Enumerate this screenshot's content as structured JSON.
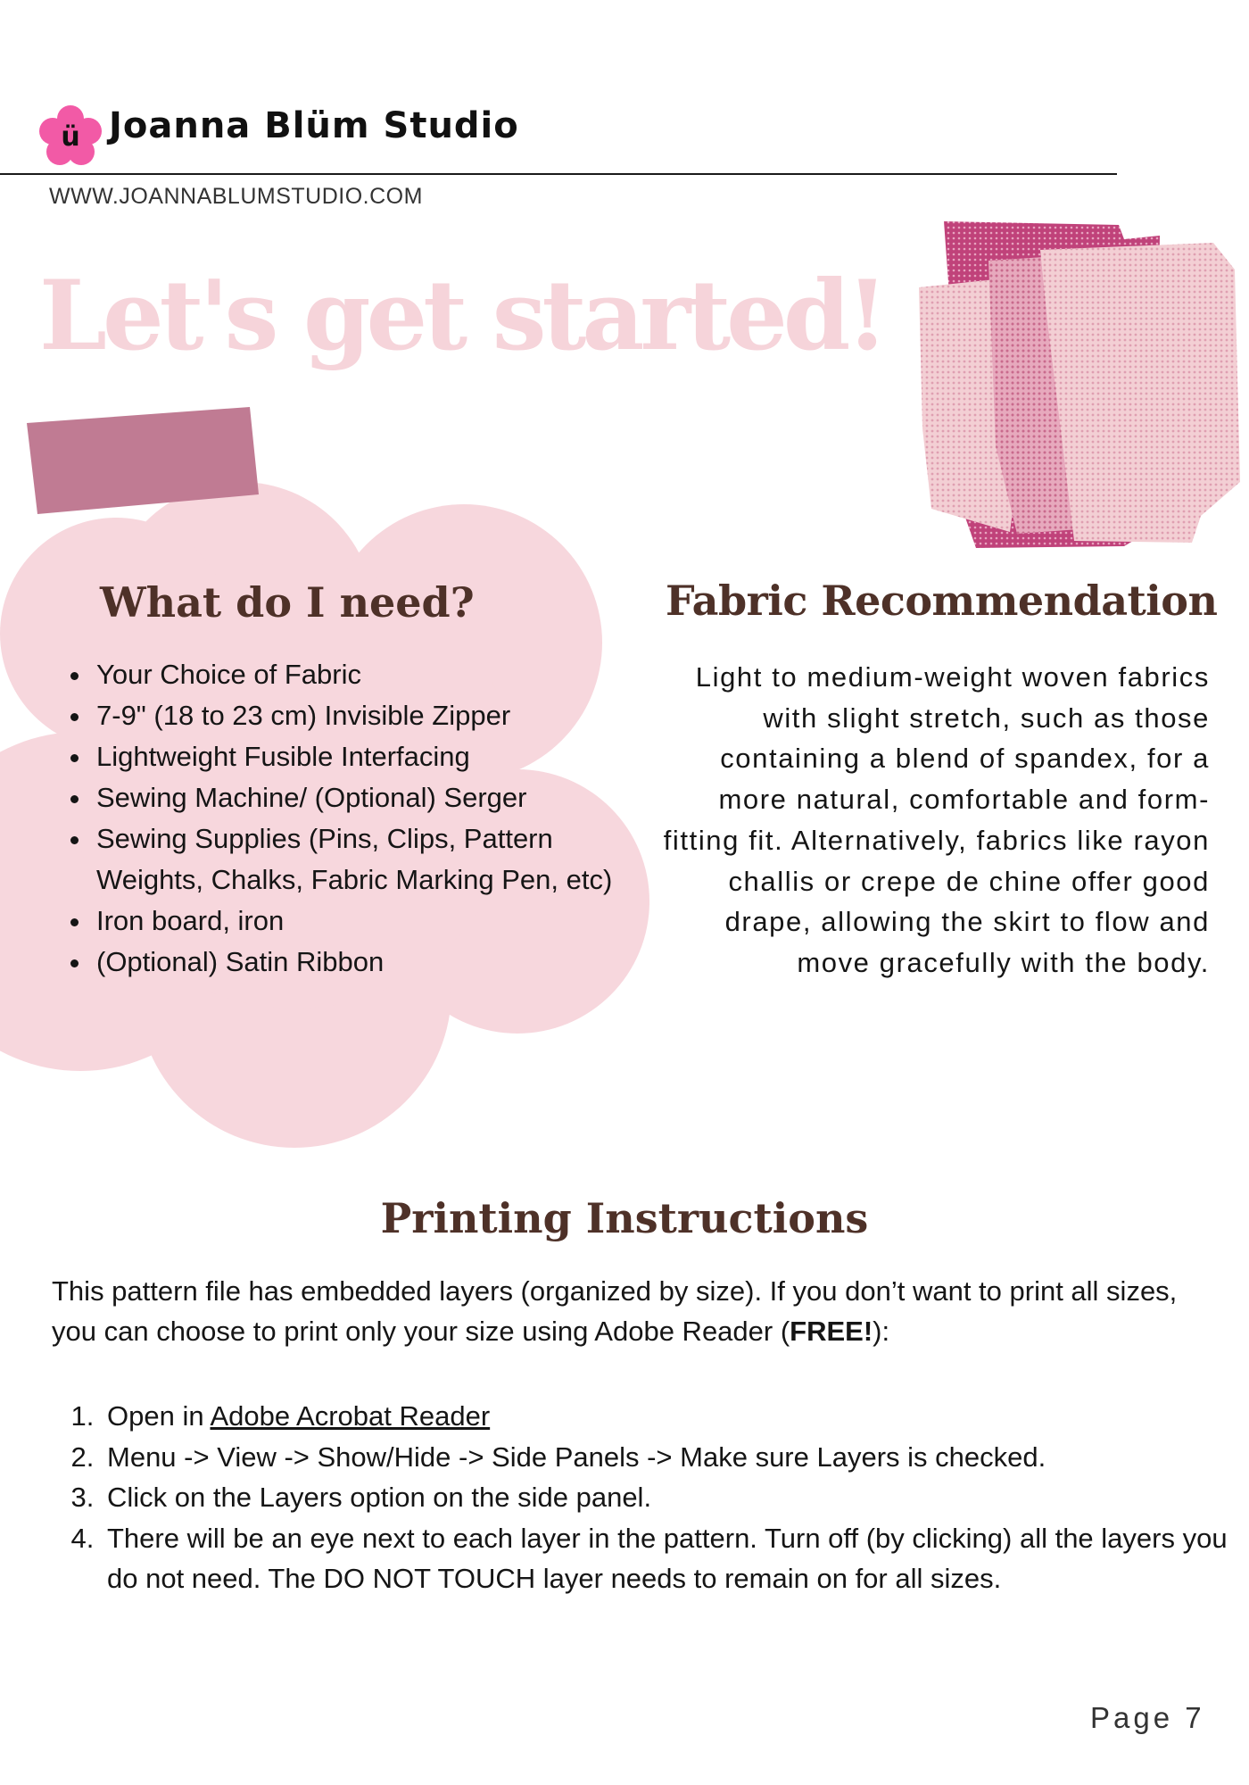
{
  "header": {
    "logo_glyph": "ü",
    "brand_name": "Joanna Blüm Studio",
    "website": "WWW.JOANNABLUMSTUDIO.COM"
  },
  "hero": {
    "title": "Let's get started!"
  },
  "supplies": {
    "heading": "What do I need?",
    "items": [
      "Your Choice of Fabric",
      "7-9\" (18 to 23 cm) Invisible Zipper",
      "Lightweight Fusible Interfacing",
      "Sewing Machine/ (Optional) Serger",
      "Sewing Supplies (Pins, Clips, Pattern Weights, Chalks, Fabric Marking Pen, etc)",
      "Iron board, iron",
      "(Optional) Satin Ribbon"
    ]
  },
  "fabric": {
    "heading": "Fabric Recommendation",
    "body": "Light to medium-weight woven fabrics with slight stretch, such as those containing a blend of spandex, for a more natural, comfortable and form-fitting fit. Alternatively, fabrics like rayon challis or crepe de chine offer good drape, allowing the skirt to flow and move gracefully with the body."
  },
  "printing": {
    "heading": "Printing Instructions",
    "intro_before": "This pattern file has embedded layers (organized by size). If you don’t want to print all sizes, you can choose to print only your size using Adobe Reader (",
    "intro_bold": "FREE!",
    "intro_after": "):",
    "step1_prefix": "Open in ",
    "step1_link": "Adobe Acrobat Reader",
    "step2": "Menu -> View -> Show/Hide -> Side Panels -> Make sure Layers is checked.",
    "step3": "Click on the Layers option on the side panel.",
    "step4": "There will be an eye next to each layer in the pattern. Turn off (by clicking) all the layers you do not need. The DO NOT TOUCH layer needs to remain on for all sizes."
  },
  "footer": {
    "page_label": "Page 7"
  },
  "colors": {
    "heading_brown": "#4e3128",
    "hero_pink": "#f6d4da",
    "blob_pink": "#f7d7dd",
    "tape_mauve": "#c07b93",
    "logo_pink": "#f25aa6"
  }
}
